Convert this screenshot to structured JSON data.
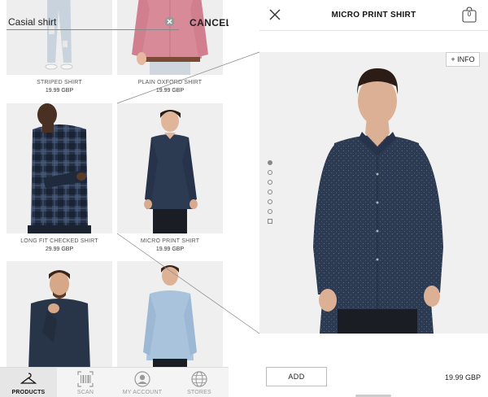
{
  "search": {
    "query": "Casial shirt",
    "cancel_label": "CANCEL"
  },
  "products": [
    {
      "name": "STRIPED SHIRT",
      "price": "19.99 GBP"
    },
    {
      "name": "PLAIN OXFORD SHIRT",
      "price": "19.99 GBP"
    },
    {
      "name": "LONG FIT CHECKED SHIRT",
      "price": "29.99 GBP"
    },
    {
      "name": "MICRO PRINT SHIRT",
      "price": "19.99 GBP"
    },
    {
      "name": "",
      "price": ""
    },
    {
      "name": "",
      "price": ""
    }
  ],
  "tabs": [
    {
      "label": "PRODUCTS",
      "icon": "hanger-icon",
      "active": true
    },
    {
      "label": "SCAN",
      "icon": "barcode-icon",
      "active": false
    },
    {
      "label": "MY ACCOUNT",
      "icon": "account-icon",
      "active": false
    },
    {
      "label": "STORES",
      "icon": "globe-icon",
      "active": false
    }
  ],
  "detail": {
    "title": "MICRO PRINT SHIRT",
    "bag_count": "0",
    "info_label": "+ INFO",
    "add_label": "ADD",
    "price": "19.99 GBP",
    "pager_count": 7,
    "pager_active": 0
  },
  "colors": {
    "shirt_navy": "#2c3a52",
    "check_navy": "#243046",
    "oxford_pink": "#d98a98",
    "oxford_blue": "#a9c3dd",
    "background_gray": "#ececec"
  }
}
